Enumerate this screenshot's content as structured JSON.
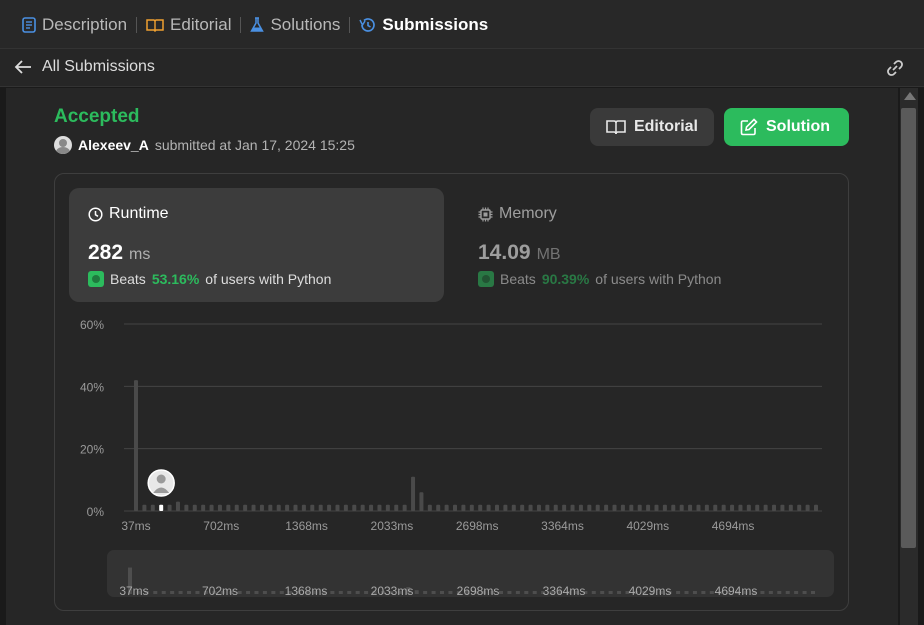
{
  "tabs": [
    {
      "label": "Description",
      "icon": "document-icon",
      "color": "#4a90e2"
    },
    {
      "label": "Editorial",
      "icon": "book-icon",
      "color": "#f0a030"
    },
    {
      "label": "Solutions",
      "icon": "flask-icon",
      "color": "#4a90e2"
    },
    {
      "label": "Submissions",
      "icon": "history-icon",
      "color": "#4a90e2"
    }
  ],
  "active_tab": "Submissions",
  "subheader": {
    "back_label": "All Submissions"
  },
  "submission": {
    "status": "Accepted",
    "username": "Alexeev_A",
    "submitted_text": "submitted at Jan 17, 2024 15:25"
  },
  "buttons": {
    "editorial": "Editorial",
    "solution": "Solution"
  },
  "runtime": {
    "title": "Runtime",
    "value": "282",
    "unit": "ms",
    "beats_prefix": "Beats",
    "beats_pct": "53.16%",
    "beats_suffix": "of users with Python"
  },
  "memory": {
    "title": "Memory",
    "value": "14.09",
    "unit": "MB",
    "beats_prefix": "Beats",
    "beats_pct": "90.39%",
    "beats_suffix": "of users with Python"
  },
  "colors": {
    "accent_green": "#2cbb5d",
    "active_bar": "#ffffff",
    "bar": "#4a4a4a"
  },
  "chart_data": {
    "type": "bar",
    "ylabels": [
      "60%",
      "40%",
      "20%",
      "0%"
    ],
    "ylim": [
      0,
      60
    ],
    "x_ticks": [
      "37ms",
      "702ms",
      "1368ms",
      "2033ms",
      "2698ms",
      "3364ms",
      "4029ms",
      "4694ms"
    ],
    "values": [
      42,
      2,
      2,
      2,
      2,
      3,
      2,
      2,
      2,
      2,
      2,
      2,
      2,
      2,
      2,
      2,
      2,
      2,
      2,
      2,
      2,
      2,
      2,
      2,
      2,
      2,
      2,
      2,
      2,
      2,
      2,
      2,
      2,
      11,
      6,
      2,
      2,
      2,
      2,
      2,
      2,
      2,
      2,
      2,
      2,
      2,
      2,
      2,
      2,
      2,
      2,
      2,
      2,
      2,
      2,
      2,
      2,
      2,
      2,
      2,
      2,
      2,
      2,
      2,
      2,
      2,
      2,
      2,
      2,
      2,
      2,
      2,
      2,
      2,
      2,
      2,
      2,
      2,
      2,
      2,
      2,
      2
    ],
    "highlight_index": 3,
    "grid": true
  }
}
